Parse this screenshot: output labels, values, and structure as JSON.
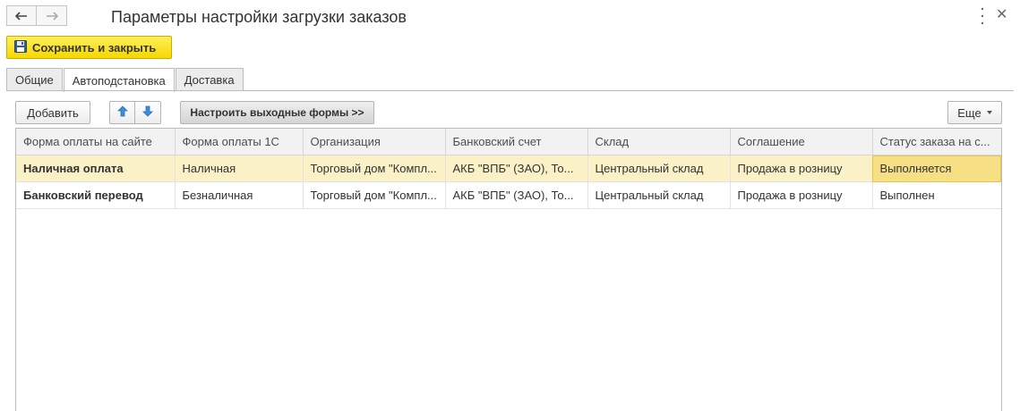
{
  "window": {
    "title": "Параметры настройки загрузки заказов"
  },
  "toolbar": {
    "save_close_label": "Сохранить и закрыть"
  },
  "tabs": [
    {
      "label": "Общие"
    },
    {
      "label": "Автоподстановка"
    },
    {
      "label": "Доставка"
    }
  ],
  "active_tab": "Автоподстановка",
  "commands": {
    "add_label": "Добавить",
    "configure_forms_label": "Настроить выходные формы >>",
    "more_label": "Еще"
  },
  "icons": {
    "back": "arrow-left-icon",
    "forward": "arrow-right-icon",
    "more": "vertical-dots-icon",
    "close": "close-icon",
    "save": "floppy-disk-icon",
    "move_up": "arrow-up-icon",
    "move_down": "arrow-down-icon"
  },
  "colors": {
    "save_button": "#f6d800",
    "selected_row": "#fbf1c6",
    "focused_cell": "#f7df85",
    "move_arrows": "#3d8ed6"
  },
  "table": {
    "columns": [
      "Форма оплаты на сайте",
      "Форма оплаты 1С",
      "Организация",
      "Банковский счет",
      "Склад",
      "Соглашение",
      "Статус заказа на с..."
    ],
    "rows": [
      {
        "cells": [
          "Наличная оплата",
          "Наличная",
          "Торговый дом \"Компл...",
          "АКБ \"ВПБ\" (ЗАО), То...",
          "Центральный склад",
          "Продажа в розницу",
          "Выполняется"
        ],
        "selected": true
      },
      {
        "cells": [
          "Банковский перевод",
          "Безналичная",
          "Торговый дом \"Компл...",
          "АКБ \"ВПБ\" (ЗАО), То...",
          "Центральный склад",
          "Продажа в розницу",
          "Выполнен"
        ],
        "selected": false
      }
    ]
  }
}
